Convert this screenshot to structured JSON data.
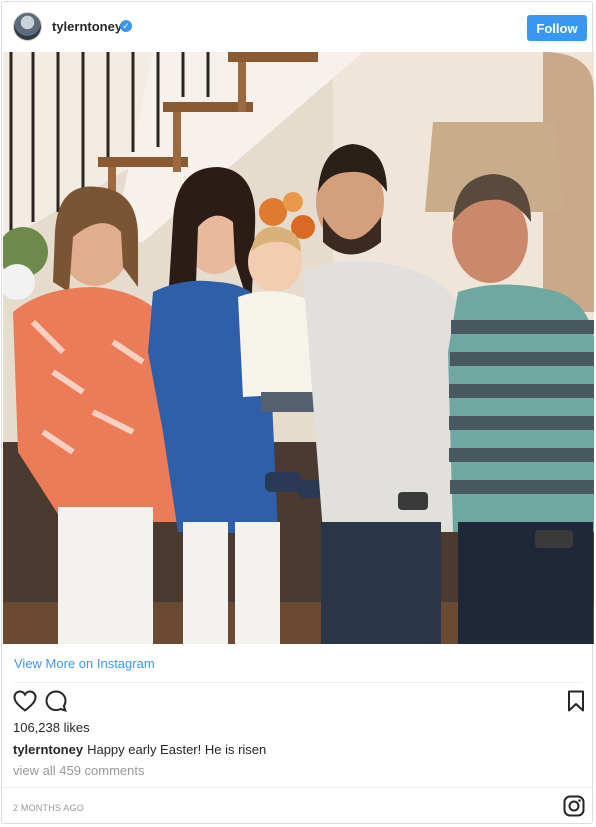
{
  "header": {
    "username": "tylerntoney",
    "verified_icon": "verified-badge-icon",
    "follow_label": "Follow"
  },
  "photo": {
    "alt": "Family Easter photo"
  },
  "links": {
    "view_more": "View More on Instagram"
  },
  "actions": {
    "like_icon": "heart-icon",
    "comment_icon": "comment-icon",
    "save_icon": "bookmark-icon"
  },
  "post": {
    "likes": "106,238 likes",
    "caption_user": "tylerntoney",
    "caption_text": "Happy early Easter! He is risen",
    "view_all_comments": "view all 459 comments",
    "timestamp": "2 MONTHS AGO"
  },
  "footer": {
    "logo_icon": "instagram-glyph-icon"
  },
  "colors": {
    "accent": "#3897f0",
    "text": "#262626",
    "muted": "#999999",
    "border": "#dbdbdb"
  }
}
